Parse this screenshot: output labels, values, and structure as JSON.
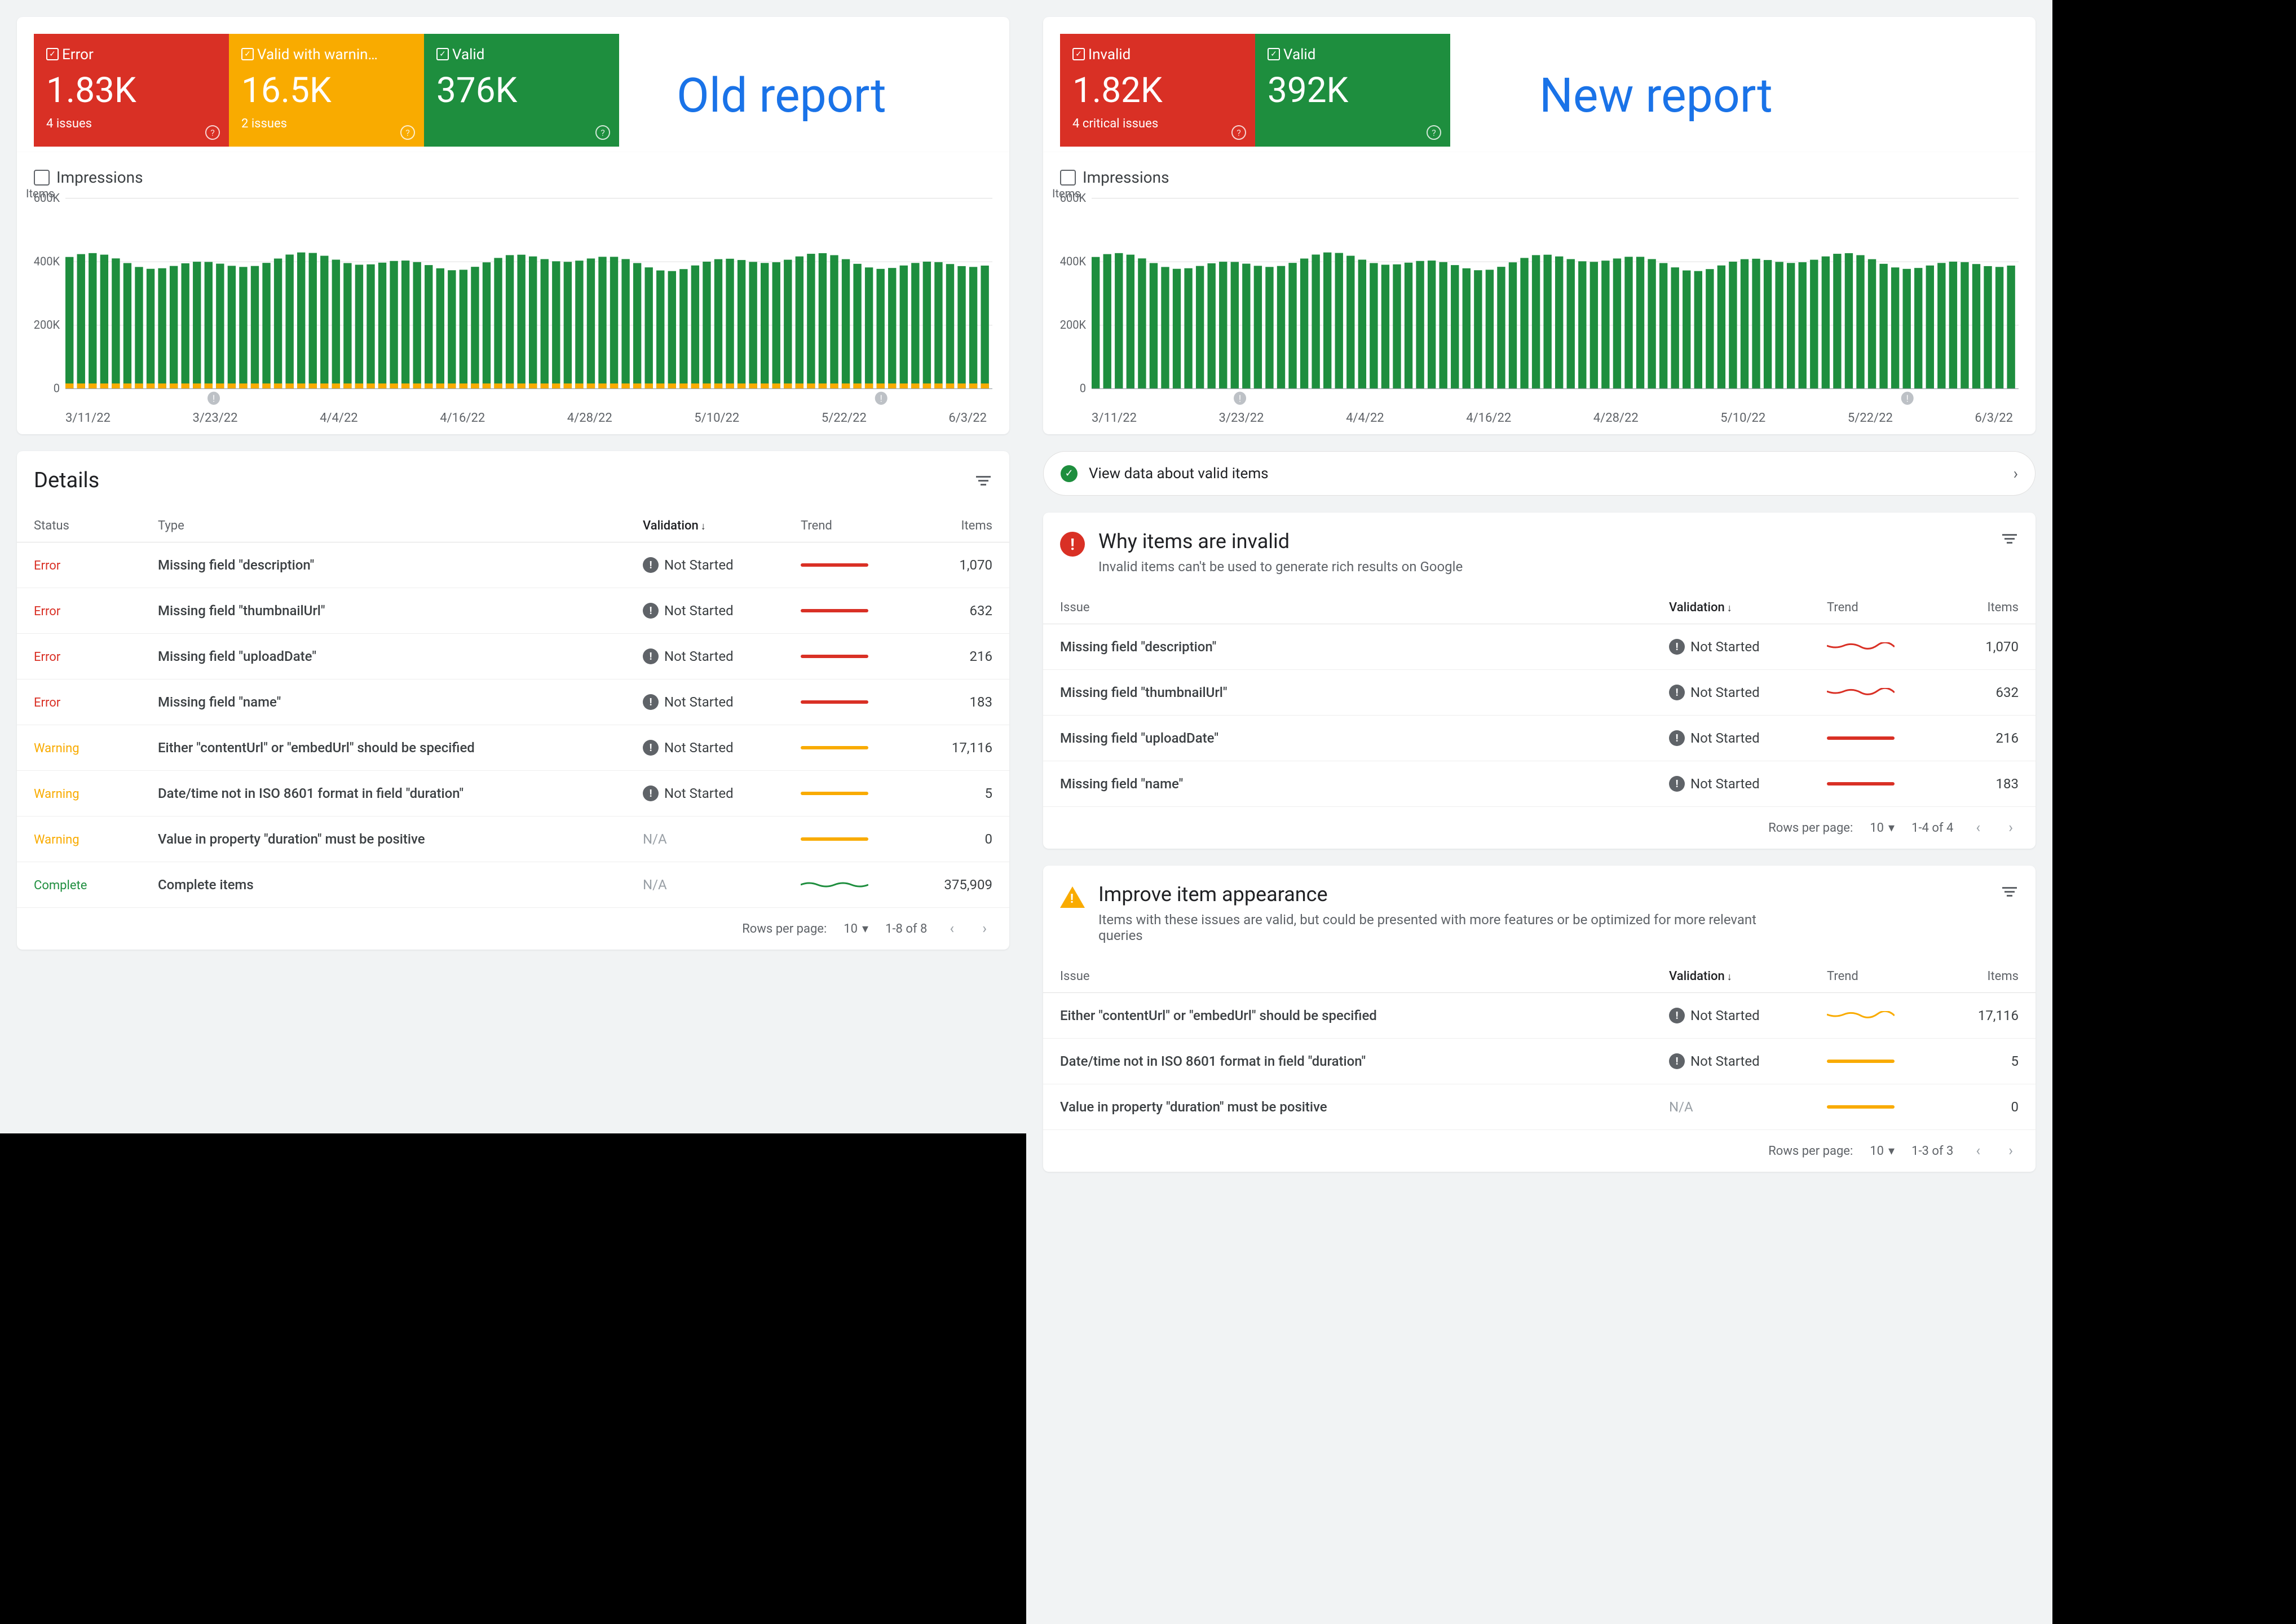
{
  "labels": {
    "old_title": "Old report",
    "new_title": "New report",
    "impressions": "Impressions",
    "items_axis": "Items",
    "details": "Details",
    "rows_per_page": "Rows per page:",
    "rows_value": "10",
    "view_valid": "View data about valid items",
    "why_invalid_title": "Why items are invalid",
    "why_invalid_sub": "Invalid items can't be used to generate rich results on Google",
    "improve_title": "Improve item appearance",
    "improve_sub": "Items with these issues are valid, but could be presented with more features or be optimized for more relevant queries",
    "col_status": "Status",
    "col_type": "Type",
    "col_issue": "Issue",
    "col_validation": "Validation",
    "col_trend": "Trend",
    "col_items": "Items",
    "not_started": "Not Started",
    "na": "N/A"
  },
  "old_cards": [
    {
      "kind": "error",
      "title": "Error",
      "value": "1.83K",
      "sub": "4 issues"
    },
    {
      "kind": "warn",
      "title": "Valid with warnin…",
      "value": "16.5K",
      "sub": "2 issues"
    },
    {
      "kind": "valid",
      "title": "Valid",
      "value": "376K",
      "sub": ""
    }
  ],
  "new_cards": [
    {
      "kind": "error",
      "title": "Invalid",
      "value": "1.82K",
      "sub": "4 critical issues"
    },
    {
      "kind": "valid",
      "title": "Valid",
      "value": "392K",
      "sub": ""
    }
  ],
  "old_pager": "1-8 of 8",
  "new_pager1": "1-4 of 4",
  "new_pager2": "1-3 of 3",
  "old_rows": [
    {
      "status": "Error",
      "type": "Missing field \"description\"",
      "val": "badge",
      "trend": "red",
      "items": "1,070"
    },
    {
      "status": "Error",
      "type": "Missing field \"thumbnailUrl\"",
      "val": "badge",
      "trend": "red",
      "items": "632"
    },
    {
      "status": "Error",
      "type": "Missing field \"uploadDate\"",
      "val": "badge",
      "trend": "red",
      "items": "216"
    },
    {
      "status": "Error",
      "type": "Missing field \"name\"",
      "val": "badge",
      "trend": "red",
      "items": "183"
    },
    {
      "status": "Warning",
      "type": "Either \"contentUrl\" or \"embedUrl\" should be specified",
      "val": "badge",
      "trend": "orange",
      "items": "17,116"
    },
    {
      "status": "Warning",
      "type": "Date/time not in ISO 8601 format in field \"duration\"",
      "val": "badge",
      "trend": "orange",
      "items": "5"
    },
    {
      "status": "Warning",
      "type": "Value in property \"duration\" must be positive",
      "val": "na",
      "trend": "orange",
      "items": "0"
    },
    {
      "status": "Complete",
      "type": "Complete items",
      "val": "na",
      "trend": "green-squiggle",
      "items": "375,909"
    }
  ],
  "invalid_rows": [
    {
      "issue": "Missing field \"description\"",
      "val": "badge",
      "trend": "red-squiggle",
      "items": "1,070"
    },
    {
      "issue": "Missing field \"thumbnailUrl\"",
      "val": "badge",
      "trend": "red-squiggle",
      "items": "632"
    },
    {
      "issue": "Missing field \"uploadDate\"",
      "val": "badge",
      "trend": "red",
      "items": "216"
    },
    {
      "issue": "Missing field \"name\"",
      "val": "badge",
      "trend": "red",
      "items": "183"
    }
  ],
  "improve_rows": [
    {
      "issue": "Either \"contentUrl\" or \"embedUrl\" should be specified",
      "val": "badge",
      "trend": "orange-squiggle",
      "items": "17,116"
    },
    {
      "issue": "Date/time not in ISO 8601 format in field \"duration\"",
      "val": "badge",
      "trend": "orange",
      "items": "5"
    },
    {
      "issue": "Value in property \"duration\" must be positive",
      "val": "na",
      "trend": "orange",
      "items": "0"
    }
  ],
  "chart_data": {
    "type": "bar",
    "ylabel": "Items",
    "ylim": [
      0,
      600000
    ],
    "yticks": [
      "0",
      "200K",
      "400K",
      "600K"
    ],
    "categories": [
      "3/11/22",
      "3/23/22",
      "4/4/22",
      "4/16/22",
      "4/28/22",
      "5/10/22",
      "5/22/22",
      "6/3/22"
    ],
    "old_series": [
      {
        "name": "Valid",
        "color": "#1e8e3e",
        "approx": 400000
      },
      {
        "name": "Valid with warnings",
        "color": "#f9ab00",
        "approx": 16500
      },
      {
        "name": "Error",
        "color": "#d93025",
        "approx": 1830
      }
    ],
    "new_series": [
      {
        "name": "Valid",
        "color": "#1e8e3e",
        "approx": 392000
      },
      {
        "name": "Invalid",
        "color": "#d93025",
        "approx": 1820
      }
    ],
    "markers": [
      {
        "position": "3/23/22"
      },
      {
        "position": "6/3/22"
      }
    ]
  }
}
